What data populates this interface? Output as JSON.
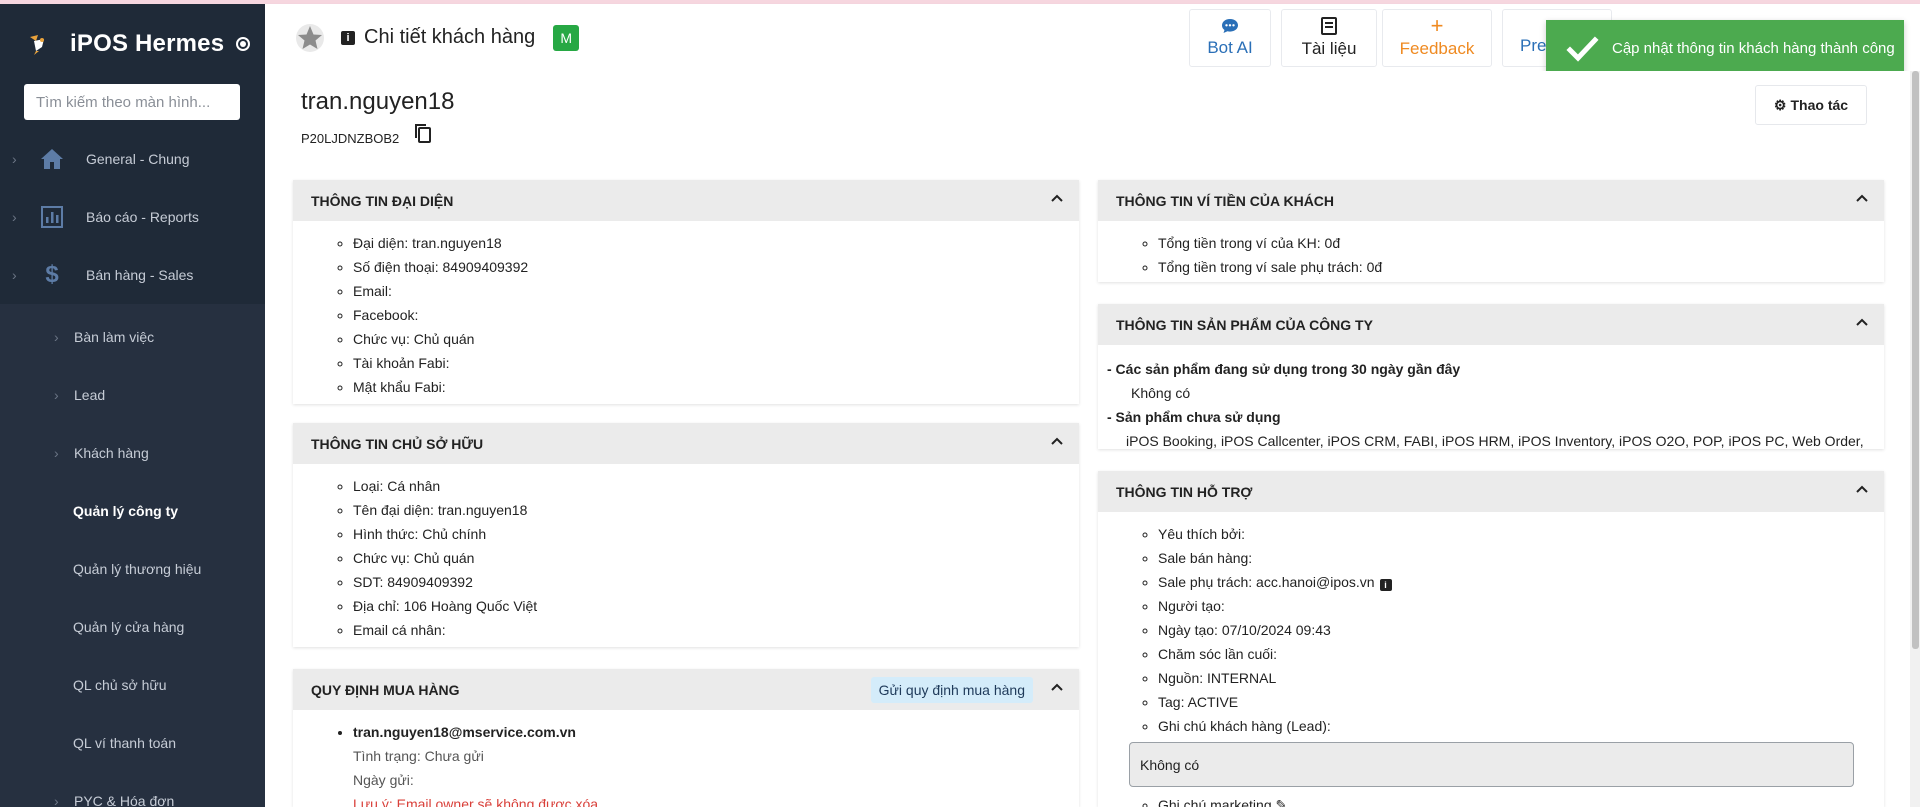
{
  "app": {
    "title": "iPOS Hermes",
    "search_placeholder": "Tìm kiếm theo màn hình..."
  },
  "sidebar": {
    "main_items": [
      {
        "label": "General - Chung",
        "icon": "home-icon"
      },
      {
        "label": "Báo cáo - Reports",
        "icon": "report-icon"
      },
      {
        "label": "Bán hàng - Sales",
        "icon": "dollar-icon"
      }
    ],
    "sub_items": [
      {
        "label": "Bàn làm việc",
        "has_chevron": true
      },
      {
        "label": "Lead",
        "has_chevron": true
      },
      {
        "label": "Khách hàng",
        "has_chevron": true
      },
      {
        "label": "Quản lý công ty",
        "active": true
      },
      {
        "label": "Quản lý thương hiệu"
      },
      {
        "label": "Quản lý cửa hàng"
      },
      {
        "label": "QL chủ sở hữu"
      },
      {
        "label": "QL ví thanh toán"
      },
      {
        "label": "PYC & Hóa đơn",
        "has_chevron": true
      }
    ]
  },
  "header": {
    "page_title": "Chi tiết khách hàng",
    "badge": "M",
    "buttons": {
      "bot_ai": "Bot AI",
      "docs": "Tài liệu",
      "feedback": "Feedback",
      "pre": "Pre"
    }
  },
  "toast": {
    "message": "Cập nhật thông tin khách hàng thành công",
    "color": "#4caa4f"
  },
  "customer": {
    "name": "tran.nguyen18",
    "code": "P20LJDNZBOB2",
    "action_label": "Thao tác"
  },
  "representative": {
    "title": "THÔNG TIN ĐẠI DIỆN",
    "items": [
      "Đại diện: tran.nguyen18",
      "Số điện thoại: 84909409392",
      "Email:",
      "Facebook:",
      "Chức vụ: Chủ quán",
      "Tài khoản Fabi:",
      "Mật khẩu Fabi:"
    ]
  },
  "owner": {
    "title": "THÔNG TIN CHỦ SỞ HỮU",
    "items": [
      "Loại: Cá nhân",
      "Tên đại diện: tran.nguyen18",
      "Hình thức: Chủ chính",
      "Chức vụ: Chủ quán",
      "SDT: 84909409392",
      "Địa chỉ: 106 Hoàng Quốc Việt",
      "Email cá nhân:"
    ]
  },
  "purchase_rules": {
    "title": "QUY ĐỊNH MUA HÀNG",
    "send_button": "Gửi quy định mua hàng",
    "email": "tran.nguyen18@mservice.com.vn",
    "status": "Tình trạng: Chưa gửi",
    "sent_date": "Ngày gửi:",
    "warning": "Lưu ý: Email owner sẽ không được xóa"
  },
  "wallet": {
    "title": "THÔNG TIN VÍ TIỀN CỦA KHÁCH",
    "items": [
      "Tổng tiền trong ví của KH: 0đ",
      "Tổng tiền trong ví sale phụ trách: 0đ"
    ]
  },
  "products": {
    "title": "THÔNG TIN SẢN PHẨM CỦA CÔNG TY",
    "used_heading": "- Các sản phẩm đang sử dụng trong 30 ngày gần đây",
    "used_value": "Không có",
    "unused_heading": "- Sản phẩm chưa sử dụng",
    "unused_value": "iPOS Booking, iPOS Callcenter, iPOS CRM, FABI, iPOS HRM, iPOS Inventory, iPOS O2O, POP, iPOS PC, Web Order,"
  },
  "support": {
    "title": "THÔNG TIN HỖ TRỢ",
    "items": [
      "Yêu thích bởi:",
      "Sale bán hàng:",
      "Sale phụ trách: acc.hanoi@ipos.vn",
      "Người tạo:",
      "Ngày tạo: 07/10/2024 09:43",
      "Chăm sóc lần cuối:",
      "Nguồn: INTERNAL",
      "Tag: ACTIVE",
      "Ghi chú khách hàng (Lead):"
    ],
    "note_value": "Không có",
    "marketing_note": "Ghi chú marketing"
  }
}
